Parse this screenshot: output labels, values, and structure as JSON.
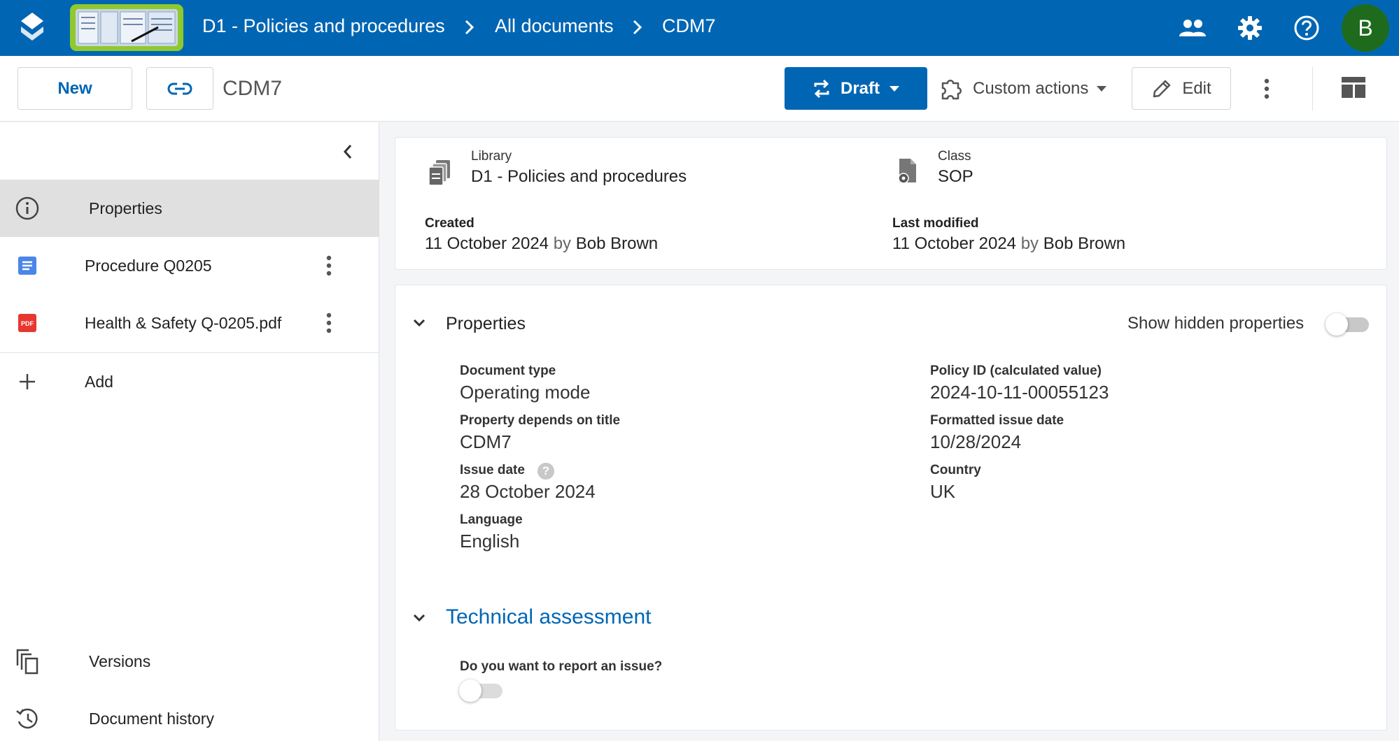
{
  "header": {
    "breadcrumbs": [
      "D1 - Policies and procedures",
      "All documents",
      "CDM7"
    ],
    "avatar_initial": "B",
    "brand_color": "#0066b3",
    "icons": [
      "people-icon",
      "gear-icon",
      "help-icon"
    ]
  },
  "toolbar": {
    "new_label": "New",
    "document_name": "CDM7",
    "draft_label": "Draft",
    "custom_actions_label": "Custom actions",
    "edit_label": "Edit"
  },
  "sidebar": {
    "items": [
      {
        "label": "Properties",
        "icon": "info-icon",
        "active": true
      },
      {
        "label": "Procedure Q0205",
        "icon": "document-icon"
      },
      {
        "label": "Health & Safety Q-0205.pdf",
        "icon": "pdf-icon",
        "icon_text": "PDF"
      },
      {
        "label": "Add",
        "icon": "plus-icon"
      },
      {
        "label": "Versions",
        "icon": "versions-icon"
      },
      {
        "label": "Document history",
        "icon": "history-icon"
      }
    ]
  },
  "summary": {
    "library_label": "Library",
    "library_value": "D1 - Policies and procedures",
    "class_label": "Class",
    "class_value": "SOP",
    "created_label": "Created",
    "created_date": "11 October 2024",
    "created_by_word": "by",
    "created_by": "Bob Brown",
    "modified_label": "Last modified",
    "modified_date": "11 October 2024",
    "modified_by_word": "by",
    "modified_by": "Bob Brown"
  },
  "properties": {
    "section_title": "Properties",
    "show_hidden_label": "Show hidden properties",
    "show_hidden_on": false,
    "fields": [
      {
        "label": "Document type",
        "value": "Operating mode"
      },
      {
        "label": "Property depends on title",
        "value": "CDM7"
      },
      {
        "label": "Issue date",
        "value": "28 October 2024",
        "help": "?"
      },
      {
        "label": "Language",
        "value": "English"
      },
      {
        "label": "Policy ID (calculated value)",
        "value": "2024-10-11-00055123"
      },
      {
        "label": "Formatted issue date",
        "value": "10/28/2024"
      },
      {
        "label": "Country",
        "value": "UK"
      }
    ]
  },
  "technical": {
    "section_title": "Technical assessment",
    "question_label": "Do you want to report an issue?",
    "question_on": false
  }
}
